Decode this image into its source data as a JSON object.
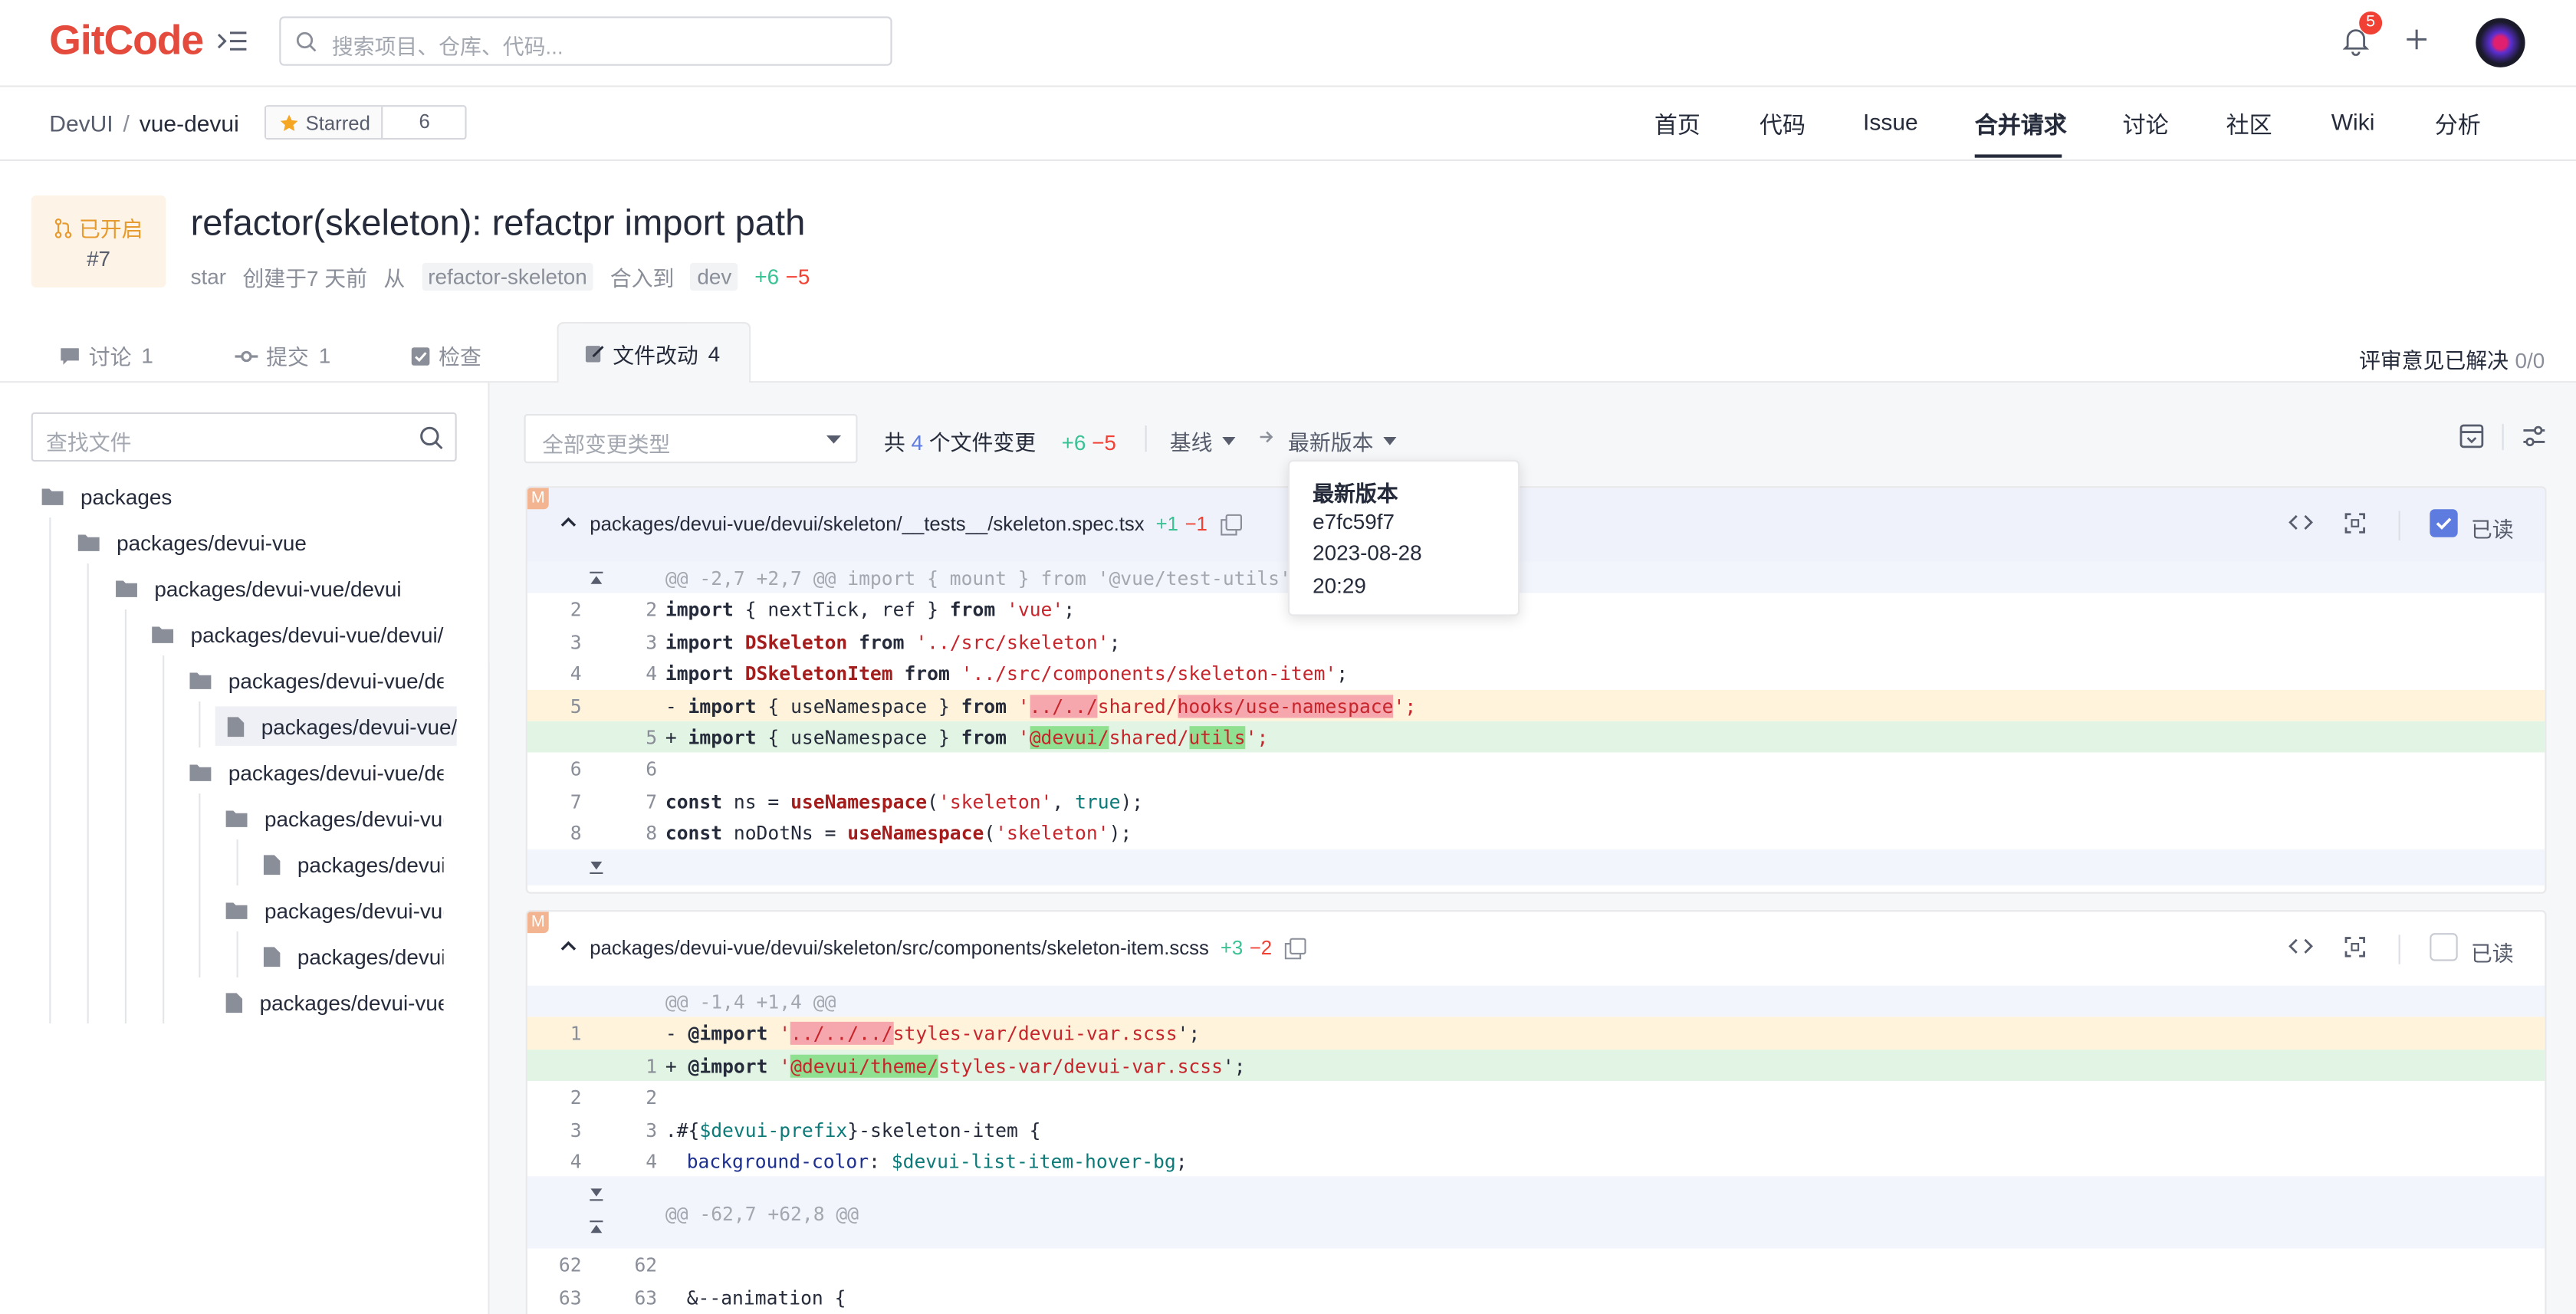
{
  "topbar": {
    "logo_text": "GitCode",
    "search_placeholder": "搜索项目、仓库、代码...",
    "notification_count": "5"
  },
  "repo": {
    "owner": "DevUI",
    "separator": "/",
    "name": "vue-devui",
    "star_label": "Starred",
    "star_count": "6",
    "nav": [
      "首页",
      "代码",
      "Issue",
      "合并请求",
      "讨论",
      "社区",
      "Wiki",
      "分析"
    ],
    "active_nav": "合并请求"
  },
  "mr": {
    "status": "已开启",
    "number": "#7",
    "title": "refactor(skeleton): refactpr import path",
    "author": "star",
    "created": "创建于7 天前",
    "from_label": "从",
    "source_branch": "refactor-skeleton",
    "merge_into": "合入到",
    "target_branch": "dev",
    "additions": "+6",
    "deletions": "−5"
  },
  "tabs": [
    {
      "label": "讨论",
      "count": "1"
    },
    {
      "label": "提交",
      "count": "1"
    },
    {
      "label": "检查",
      "count": ""
    },
    {
      "label": "文件改动",
      "count": "4"
    }
  ],
  "review_status": {
    "label": "评审意见已解决",
    "value": "0/0"
  },
  "sidebar": {
    "search_placeholder": "查找文件",
    "tree": [
      "packages",
      "packages/devui-vue",
      "packages/devui-vue/devui",
      "packages/devui-vue/devui/skeleton",
      "packages/devui-vue/devui/skeleton/__tests__",
      "packages/devui-vue/devui/skeleton/__tests__/skeleton.spec.tsx",
      "packages/devui-vue/devui/skeleton/src",
      "packages/devui-vue/devui/skeleton/src/components",
      "packages/devui-vue/devui/skeleton/src/components/skeleton-item.scss",
      "packages/devui-vue/devui/skeleton/src/styles",
      "packages/devui-vue/devui/skeleton/src/styles/skeleton.scss",
      "packages/devui-vue/devui/skeleton/src/skeleton.tsx"
    ]
  },
  "toolbar": {
    "type_filter": "全部变更类型",
    "summary_prefix": "共",
    "file_count": "4",
    "summary_suffix": "个文件变更",
    "additions": "+6",
    "deletions": "−5",
    "base": "基线",
    "latest": "最新版本"
  },
  "tooltip": {
    "title": "最新版本",
    "commit": "e7fc59f7",
    "date": "2023-08-28",
    "time": "20:29"
  },
  "files": [
    {
      "status": "M",
      "path": "packages/devui-vue/devui/skeleton/__tests__/skeleton.spec.tsx",
      "additions": "+1",
      "deletions": "−1",
      "read_label": "已读",
      "read": true,
      "hunk": "@@ -2,7 +2,7 @@ import { mount } from '@vue/test-utils';",
      "lines": [
        {
          "old": "2",
          "new": "2",
          "type": "ctx"
        },
        {
          "old": "3",
          "new": "3",
          "type": "ctx"
        },
        {
          "old": "4",
          "new": "4",
          "type": "ctx"
        },
        {
          "old": "5",
          "new": "",
          "type": "del"
        },
        {
          "old": "",
          "new": "5",
          "type": "add"
        },
        {
          "old": "6",
          "new": "6",
          "type": "ctx"
        },
        {
          "old": "7",
          "new": "7",
          "type": "ctx"
        },
        {
          "old": "8",
          "new": "8",
          "type": "ctx"
        }
      ],
      "code": [
        {
          "a": "import",
          "b": " { nextTick, ref } ",
          "c": "from",
          "d": " ",
          "e": "'vue'",
          "f": ";"
        },
        {
          "a": "import",
          "b": " DSkeleton ",
          "c": "from",
          "d": " ",
          "e": "'../src/skeleton'",
          "f": ";"
        },
        {
          "a": "import",
          "b": " DSkeletonItem ",
          "c": "from",
          "d": " ",
          "e": "'../src/components/skeleton-item'",
          "f": ";"
        },
        {
          "a": "import",
          "b": " { useNamespace } ",
          "c": "from",
          "d": " '",
          "e1": "../../",
          "e2": "shared/",
          "e3": "hooks/use-namespace",
          "f": "';"
        },
        {
          "a": "import",
          "b": " { useNamespace } ",
          "c": "from",
          "d": " '",
          "e1": "@devui/",
          "e2": "shared/",
          "e3": "utils",
          "f": "';"
        },
        {
          "a": "",
          "b": "",
          "c": "",
          "d": "",
          "e": "",
          "f": ""
        },
        {
          "a": "const",
          "b": " ns = ",
          "c": "useNamespace",
          "d": "(",
          "e": "'skeleton'",
          "g": ", ",
          "h": "true",
          "f": ");"
        },
        {
          "a": "const",
          "b": " noDotNs = ",
          "c": "useNamespace",
          "d": "(",
          "e": "'skeleton'",
          "f": ");"
        }
      ]
    },
    {
      "status": "M",
      "path": "packages/devui-vue/devui/skeleton/src/components/skeleton-item.scss",
      "additions": "+3",
      "deletions": "−2",
      "read_label": "已读",
      "read": false,
      "hunk": "@@ -1,4 +1,4 @@",
      "hunk2": "@@ -62,7 +62,8 @@",
      "lines": [
        {
          "old": "1",
          "new": "",
          "type": "del"
        },
        {
          "old": "",
          "new": "1",
          "type": "add"
        },
        {
          "old": "2",
          "new": "2",
          "type": "ctx"
        },
        {
          "old": "3",
          "new": "3",
          "type": "ctx"
        },
        {
          "old": "4",
          "new": "4",
          "type": "ctx"
        },
        {
          "old": "62",
          "new": "62",
          "type": "ctx"
        },
        {
          "old": "63",
          "new": "63",
          "type": "ctx"
        }
      ],
      "code": [
        {
          "a": "@import",
          "d": " '",
          "e1": "../../../",
          "e2": "styles-var/devui-var.scss",
          "f": "';"
        },
        {
          "a": "@import",
          "d": " '",
          "e1": "@devui/theme/",
          "e2": "styles-var/devui-var.scss",
          "f": "';"
        },
        {
          "a": ""
        },
        {
          "a": ".#{",
          "v": "$devui-prefix",
          "b": "}-skeleton-item {"
        },
        {
          "p": "background-color",
          "b": ": ",
          "v": "$devui-list-item-hover-bg",
          "f": ";"
        },
        {
          "a": ""
        },
        {
          "b": "&--animation {"
        }
      ]
    }
  ]
}
